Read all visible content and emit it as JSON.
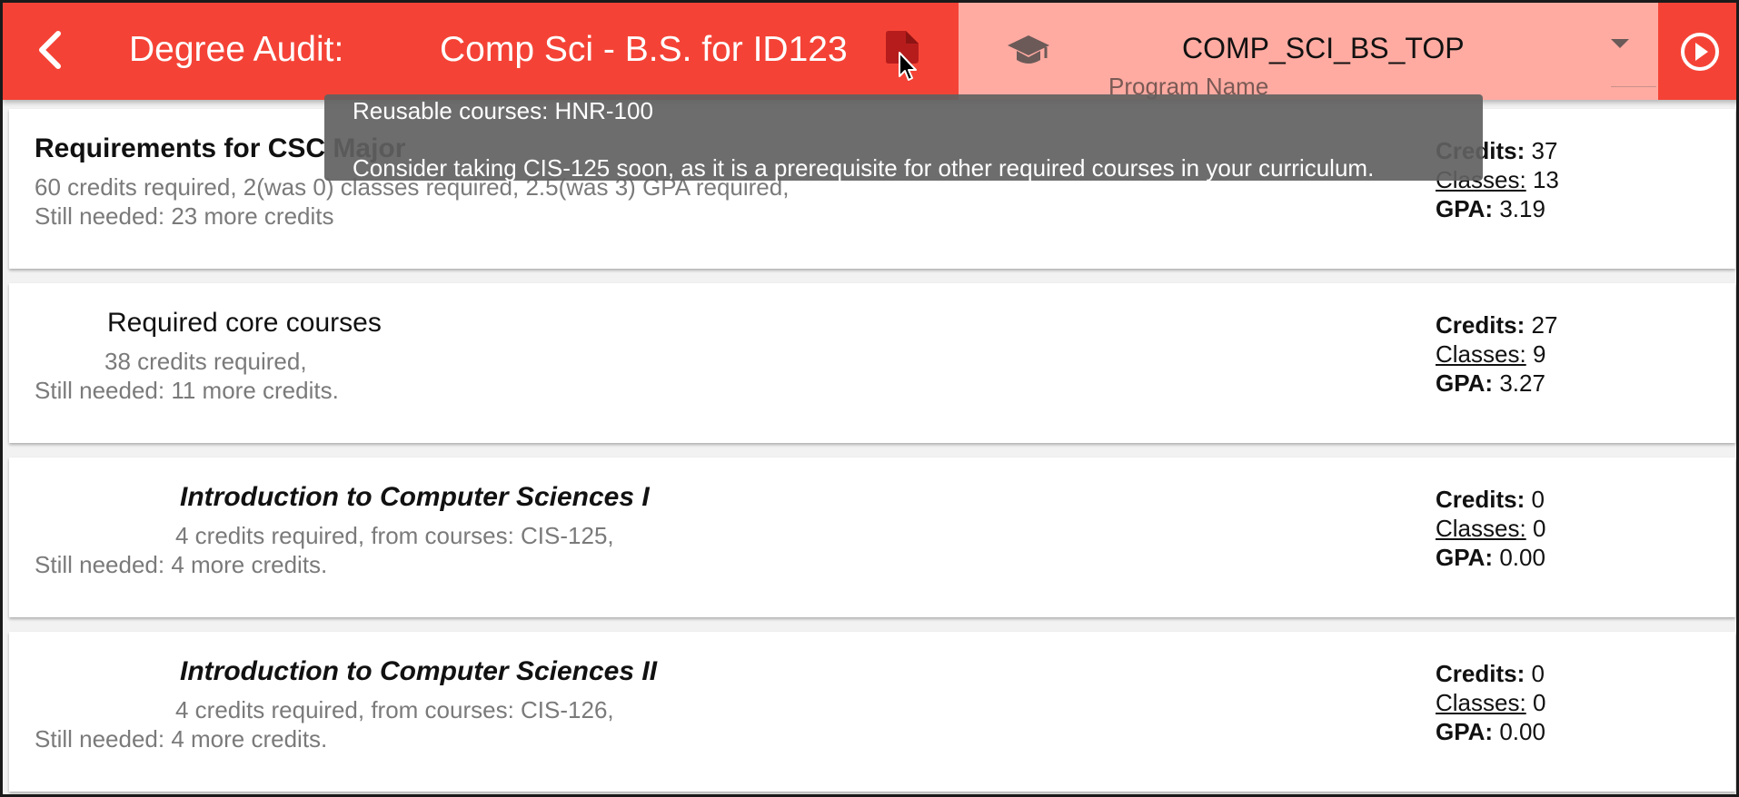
{
  "header": {
    "title_label": "Degree Audit:",
    "title_value": "Comp Sci - B.S. for ID123",
    "back_icon": "arrow-left-icon",
    "doc_icon": "file-document-icon",
    "program": {
      "icon": "graduation-cap-icon",
      "value": "COMP_SCI_BS_TOP",
      "label": "Program Name"
    },
    "run_icon": "play-circle-icon",
    "colors": {
      "bar": "#f44336",
      "program_panel": "#ffaba2"
    }
  },
  "tooltip": {
    "line1": "Reusable courses: HNR-100",
    "line2": "Consider taking CIS-125 soon, as it is a prerequisite for other required courses in your curriculum."
  },
  "stat_labels": {
    "credits": "Credits:",
    "classes": "Classes:",
    "gpa": "GPA:"
  },
  "requirements": [
    {
      "title": "Requirements for CSC Major",
      "line1": "60 credits required, 2(was 0) classes required, 2.5(was 3) GPA required,",
      "line2": "Still needed: 23 more credits",
      "credits": "37",
      "classes": "13",
      "gpa": "3.19"
    },
    {
      "title": "Required core courses",
      "line1": "38 credits required,",
      "line2": "Still needed: 11 more credits.",
      "credits": "27",
      "classes": "9",
      "gpa": "3.27"
    },
    {
      "title": "Introduction to Computer Sciences I",
      "line1": "4 credits required, from courses: CIS-125,",
      "line2": "Still needed: 4 more credits.",
      "credits": "0",
      "classes": "0",
      "gpa": "0.00"
    },
    {
      "title": "Introduction to Computer Sciences II",
      "line1": "4 credits required, from courses: CIS-126,",
      "line2": "Still needed: 4 more credits.",
      "credits": "0",
      "classes": "0",
      "gpa": "0.00"
    }
  ]
}
